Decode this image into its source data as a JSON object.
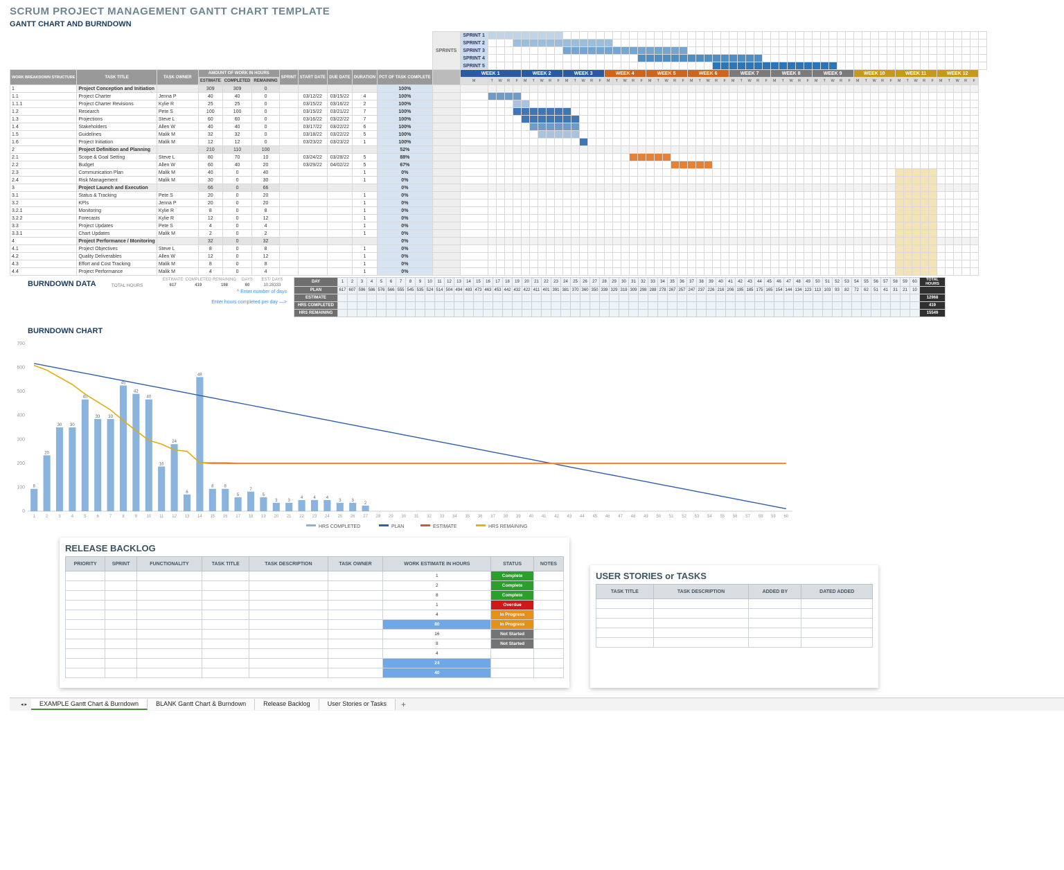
{
  "titles": {
    "main": "SCRUM PROJECT MANAGEMENT GANTT CHART TEMPLATE",
    "sub": "GANTT CHART AND BURNDOWN",
    "burndata": "BURNDOWN DATA",
    "burnchart": "BURNDOWN CHART",
    "backlog": "RELEASE BACKLOG",
    "stories": "USER STORIES or TASKS"
  },
  "headers": {
    "wbs": "WORK BREAKDOWN STRUCTURE",
    "title": "TASK TITLE",
    "owner": "TASK OWNER",
    "amtgroup": "AMOUNT OF WORK IN HOURS",
    "est": "ESTIMATE",
    "comp": "COMPLETED",
    "rem": "REMAINING",
    "sprint": "SPRINT",
    "start": "START DATE",
    "due": "DUE DATE",
    "dur": "DURATION",
    "pct": "PCT OF TASK COMPLETE",
    "sprints": "SPRINTS"
  },
  "sprintlabels": [
    "SPRINT 1",
    "SPRINT 2",
    "SPRINT 3",
    "SPRINT 4",
    "SPRINT 5"
  ],
  "weeks": [
    {
      "label": "WEEK 1",
      "cls": "w-blue"
    },
    {
      "label": "WEEK 2",
      "cls": "w-blue"
    },
    {
      "label": "WEEK 3",
      "cls": "w-blue"
    },
    {
      "label": "WEEK 4",
      "cls": "w-orange"
    },
    {
      "label": "WEEK 5",
      "cls": "w-orange"
    },
    {
      "label": "WEEK 6",
      "cls": "w-orange"
    },
    {
      "label": "WEEK 7",
      "cls": "w-gray"
    },
    {
      "label": "WEEK 8",
      "cls": "w-gray"
    },
    {
      "label": "WEEK 9",
      "cls": "w-gray"
    },
    {
      "label": "WEEK 10",
      "cls": "w-gold"
    },
    {
      "label": "WEEK 11",
      "cls": "w-gold"
    },
    {
      "label": "WEEK 12",
      "cls": "w-gold"
    }
  ],
  "daylabels": [
    "M",
    "T",
    "W",
    "R",
    "F"
  ],
  "rows": [
    {
      "wbs": "1",
      "title": "Project Conception and Initiation",
      "owner": "",
      "e": 309,
      "c": 309,
      "r": 0,
      "sprint": "",
      "start": "",
      "due": "",
      "dur": "",
      "pct": "100%",
      "cat": true,
      "bars": []
    },
    {
      "wbs": "1.1",
      "title": "Project Charter",
      "owner": "Jenna P",
      "e": 40,
      "c": 40,
      "r": 0,
      "sprint": "",
      "start": "03/12/22",
      "due": "03/15/22",
      "dur": 4,
      "pct": "100%",
      "bars": [
        [
          0,
          1,
          4,
          "b2"
        ]
      ]
    },
    {
      "wbs": "1.1.1",
      "title": "Project Charter Revisions",
      "owner": "Kylie R",
      "e": 25,
      "c": 25,
      "r": 0,
      "sprint": "",
      "start": "03/15/22",
      "due": "03/16/22",
      "dur": 2,
      "pct": "100%",
      "bars": [
        [
          0,
          4,
          2,
          "b1"
        ]
      ]
    },
    {
      "wbs": "1.2",
      "title": "Research",
      "owner": "Pete S",
      "e": 100,
      "c": 100,
      "r": 0,
      "sprint": "",
      "start": "03/15/22",
      "due": "03/21/22",
      "dur": 7,
      "pct": "100%",
      "bars": [
        [
          0,
          4,
          7,
          "b3"
        ]
      ]
    },
    {
      "wbs": "1.3",
      "title": "Projections",
      "owner": "Steve L",
      "e": 60,
      "c": 60,
      "r": 0,
      "sprint": "",
      "start": "03/16/22",
      "due": "03/22/22",
      "dur": 7,
      "pct": "100%",
      "bars": [
        [
          1,
          0,
          7,
          "b3"
        ]
      ]
    },
    {
      "wbs": "1.4",
      "title": "Stakeholders",
      "owner": "Allen W",
      "e": 40,
      "c": 40,
      "r": 0,
      "sprint": "",
      "start": "03/17/22",
      "due": "03/22/22",
      "dur": 6,
      "pct": "100%",
      "bars": [
        [
          1,
          1,
          6,
          "b2"
        ]
      ]
    },
    {
      "wbs": "1.5",
      "title": "Guidelines",
      "owner": "Malik M",
      "e": 32,
      "c": 32,
      "r": 0,
      "sprint": "",
      "start": "03/18/22",
      "due": "03/22/22",
      "dur": 5,
      "pct": "100%",
      "bars": [
        [
          1,
          2,
          5,
          "b1"
        ]
      ]
    },
    {
      "wbs": "1.6",
      "title": "Project Initiation",
      "owner": "Malik M",
      "e": 12,
      "c": 12,
      "r": 0,
      "sprint": "",
      "start": "03/23/22",
      "due": "03/23/22",
      "dur": 1,
      "pct": "100%",
      "bars": [
        [
          2,
          2,
          1,
          "b3"
        ]
      ]
    },
    {
      "wbs": "2",
      "title": "Project Definition and Planning",
      "owner": "",
      "e": 210,
      "c": 110,
      "r": 100,
      "sprint": "",
      "start": "",
      "due": "",
      "dur": "",
      "pct": "52%",
      "cat": true,
      "bars": []
    },
    {
      "wbs": "2.1",
      "title": "Scope & Goal Setting",
      "owner": "Steve L",
      "e": 80,
      "c": 70,
      "r": 10,
      "sprint": "",
      "start": "03/24/22",
      "due": "03/28/22",
      "dur": 5,
      "pct": "88%",
      "bars": [
        [
          3,
          3,
          5,
          "o"
        ]
      ]
    },
    {
      "wbs": "2.2",
      "title": "Budget",
      "owner": "Allen W",
      "e": 60,
      "c": 40,
      "r": 20,
      "sprint": "",
      "start": "03/29/22",
      "due": "04/02/22",
      "dur": 5,
      "pct": "67%",
      "bars": [
        [
          4,
          3,
          5,
          "o"
        ]
      ]
    },
    {
      "wbs": "2.3",
      "title": "Communication Plan",
      "owner": "Malik M",
      "e": 40,
      "c": 0,
      "r": 40,
      "sprint": "",
      "start": "",
      "due": "",
      "dur": 1,
      "pct": "0%",
      "bars": [],
      "gold": true
    },
    {
      "wbs": "2.4",
      "title": "Risk Management",
      "owner": "Malik M",
      "e": 30,
      "c": 0,
      "r": 30,
      "sprint": "",
      "start": "",
      "due": "",
      "dur": 1,
      "pct": "0%",
      "bars": [],
      "gold": true
    },
    {
      "wbs": "3",
      "title": "Project Launch and Execution",
      "owner": "",
      "e": 66,
      "c": 0,
      "r": 66,
      "sprint": "",
      "start": "",
      "due": "",
      "dur": "",
      "pct": "0%",
      "cat": true,
      "bars": [],
      "gold": true
    },
    {
      "wbs": "3.1",
      "title": "Status & Tracking",
      "owner": "Pete S",
      "e": 20,
      "c": 0,
      "r": 20,
      "sprint": "",
      "start": "",
      "due": "",
      "dur": 1,
      "pct": "0%",
      "bars": [],
      "gold": true
    },
    {
      "wbs": "3.2",
      "title": "KPIs",
      "owner": "Jenna P",
      "e": 20,
      "c": 0,
      "r": 20,
      "sprint": "",
      "start": "",
      "due": "",
      "dur": 1,
      "pct": "0%",
      "bars": [],
      "gold": true
    },
    {
      "wbs": "3.2.1",
      "title": "Monitoring",
      "owner": "Kylie R",
      "e": 8,
      "c": 0,
      "r": 8,
      "sprint": "",
      "start": "",
      "due": "",
      "dur": 1,
      "pct": "0%",
      "bars": [],
      "gold": true
    },
    {
      "wbs": "3.2.2",
      "title": "Forecasts",
      "owner": "Kylie R",
      "e": 12,
      "c": 0,
      "r": 12,
      "sprint": "",
      "start": "",
      "due": "",
      "dur": 1,
      "pct": "0%",
      "bars": [],
      "gold": true
    },
    {
      "wbs": "3.3",
      "title": "Project Updates",
      "owner": "Pete S",
      "e": 4,
      "c": 0,
      "r": 4,
      "sprint": "",
      "start": "",
      "due": "",
      "dur": 1,
      "pct": "0%",
      "bars": [],
      "gold": true
    },
    {
      "wbs": "3.3.1",
      "title": "Chart Updates",
      "owner": "Malik M",
      "e": 2,
      "c": 0,
      "r": 2,
      "sprint": "",
      "start": "",
      "due": "",
      "dur": 1,
      "pct": "0%",
      "bars": [],
      "gold": true
    },
    {
      "wbs": "4",
      "title": "Project Performance / Monitoring",
      "owner": "",
      "e": 32,
      "c": 0,
      "r": 32,
      "sprint": "",
      "start": "",
      "due": "",
      "dur": "",
      "pct": "0%",
      "cat": true,
      "bars": [],
      "gold": true
    },
    {
      "wbs": "4.1",
      "title": "Project Objectives",
      "owner": "Steve L",
      "e": 8,
      "c": 0,
      "r": 8,
      "sprint": "",
      "start": "",
      "due": "",
      "dur": 1,
      "pct": "0%",
      "bars": [],
      "gold": true
    },
    {
      "wbs": "4.2",
      "title": "Quality Deliverables",
      "owner": "Allen W",
      "e": 12,
      "c": 0,
      "r": 12,
      "sprint": "",
      "start": "",
      "due": "",
      "dur": 1,
      "pct": "0%",
      "bars": [],
      "gold": true
    },
    {
      "wbs": "4.3",
      "title": "Effort and Cost Tracking",
      "owner": "Malik M",
      "e": 8,
      "c": 0,
      "r": 8,
      "sprint": "",
      "start": "",
      "due": "",
      "dur": 1,
      "pct": "0%",
      "bars": [],
      "gold": true
    },
    {
      "wbs": "4.4",
      "title": "Project Performance",
      "owner": "Malik M",
      "e": 4,
      "c": 0,
      "r": 4,
      "sprint": "",
      "start": "",
      "due": "",
      "dur": 1,
      "pct": "0%",
      "bars": [],
      "gold": true
    }
  ],
  "totals": {
    "label": "TOTAL HOURS",
    "e": 617,
    "c": 419,
    "r": 198,
    "days": 60,
    "estdays": "10.28333",
    "hint1": "^  Enter number of days",
    "hint2": "Enter hours completed per day —>",
    "sublabels": {
      "e": "ESTIMATE",
      "c": "COMPLETED",
      "r": "REMAINING",
      "d": "DAYS",
      "ed": "EST/ DAYS"
    }
  },
  "burntbl": {
    "rows": [
      "DAY",
      "PLAN",
      "ESTIMATE",
      "HRS COMPLETED",
      "HRS REMAINING"
    ],
    "totals_label": "TOTAL HOURS",
    "days": 60,
    "plan": [
      617,
      606.7,
      596.4,
      586.1,
      575.9,
      565.6,
      555.3,
      545,
      534.7,
      524.4,
      514.2,
      503.9,
      493.6,
      483.3,
      473,
      462.8,
      452.5,
      442.2,
      431.9,
      421.6,
      411.3,
      401.1,
      390.8,
      380.5,
      370.2,
      359.9,
      349.6,
      339.4,
      329.1,
      318.8,
      308.5,
      298.2,
      287.9,
      277.7,
      267.4,
      257.1,
      246.8,
      236.5,
      226.2,
      216,
      205.7,
      195.4,
      185.1,
      174.8,
      164.5,
      154.3,
      144,
      133.7,
      123.4,
      113.1,
      102.8,
      92.6,
      82.3,
      72,
      61.7,
      51.4,
      41.1,
      30.9,
      20.6,
      10.3
    ],
    "total_estimate": 12968,
    "total_completed": 419,
    "total_remaining": 15549
  },
  "chart_data": {
    "type": "bar+line",
    "title": "",
    "x": [
      1,
      2,
      3,
      4,
      5,
      6,
      7,
      8,
      9,
      10,
      11,
      12,
      13,
      14,
      15,
      16,
      17,
      18,
      19,
      20,
      21,
      22,
      23,
      24,
      25,
      26,
      27,
      28,
      29,
      30,
      31,
      32,
      33,
      34,
      35,
      36,
      37,
      38,
      39,
      40,
      41,
      42,
      43,
      44,
      45,
      46,
      47,
      48,
      49,
      50,
      51,
      52,
      53,
      54,
      55,
      56,
      57,
      58,
      59,
      60
    ],
    "series": [
      {
        "name": "HRS COMPLETED",
        "type": "bar",
        "color": "#8ab4dd",
        "values": [
          8,
          20,
          30,
          30,
          40,
          33,
          33,
          45,
          42,
          40,
          16,
          24,
          6,
          48,
          8,
          8,
          5,
          7,
          5,
          3,
          3,
          4,
          4,
          4,
          3,
          3,
          2,
          0,
          0,
          0,
          0,
          0,
          0,
          0,
          0,
          0,
          0,
          0,
          0,
          0,
          0,
          0,
          0,
          0,
          0,
          0,
          0,
          0,
          0,
          0,
          0,
          0,
          0,
          0,
          0,
          0,
          0,
          0,
          0,
          0
        ]
      },
      {
        "name": "PLAN",
        "type": "line",
        "color": "#2f5fa8",
        "values": [
          617,
          606.7,
          596.4,
          586.1,
          575.9,
          565.6,
          555.3,
          545,
          534.7,
          524.4,
          514.2,
          503.9,
          493.6,
          483.3,
          473,
          462.8,
          452.5,
          442.2,
          431.9,
          421.6,
          411.3,
          401.1,
          390.8,
          380.5,
          370.2,
          359.9,
          349.6,
          339.4,
          329.1,
          318.8,
          308.5,
          298.2,
          287.9,
          277.7,
          267.4,
          257.1,
          246.8,
          236.5,
          226.2,
          216,
          205.7,
          195.4,
          185.1,
          174.8,
          164.5,
          154.3,
          144,
          133.7,
          123.4,
          113.1,
          102.8,
          92.6,
          82.3,
          72,
          61.7,
          51.4,
          41.1,
          30.9,
          20.6,
          10.3
        ]
      },
      {
        "name": "ESTIMATE",
        "type": "line",
        "color": "#d6582f",
        "values": [
          609,
          589,
          559,
          529,
          489,
          456,
          423,
          378,
          336,
          296,
          280,
          256,
          250,
          202,
          202,
          202,
          200,
          200,
          200,
          200,
          200,
          200,
          200,
          200,
          200,
          200,
          200,
          200,
          200,
          200,
          200,
          200,
          200,
          200,
          200,
          200,
          200,
          200,
          200,
          200,
          200,
          200,
          200,
          200,
          200,
          200,
          200,
          200,
          200,
          200,
          200,
          200,
          200,
          200,
          200,
          200,
          200,
          200,
          200,
          200
        ]
      },
      {
        "name": "HRS REMAINING",
        "type": "line",
        "color": "#e3b400",
        "values": [
          609,
          589,
          559,
          529,
          489,
          456,
          423,
          378,
          336,
          296,
          280,
          256,
          250,
          202,
          198,
          198,
          198,
          198,
          198,
          198,
          198,
          198,
          198,
          198,
          198,
          198,
          198,
          198,
          198,
          198,
          198,
          198,
          198,
          198,
          198,
          198,
          198,
          198,
          198,
          198,
          198,
          198,
          198,
          198,
          198,
          198,
          198,
          198,
          198,
          198,
          198,
          198,
          198,
          198,
          198,
          198,
          198,
          198,
          198,
          198
        ]
      }
    ],
    "ylim_left": [
      0,
      700
    ],
    "ylim_right": [
      0,
      60
    ],
    "yticks_left": [
      0,
      100,
      200,
      300,
      400,
      500,
      600,
      700
    ],
    "legend": [
      "HRS COMPLETED",
      "PLAN",
      "ESTIMATE",
      "HRS REMAINING"
    ]
  },
  "backlog": {
    "headers": [
      "PRIORITY",
      "SPRINT",
      "FUNCTIONALITY",
      "TASK TITLE",
      "TASK DESCRIPTION",
      "TASK OWNER",
      "WORK ESTIMATE IN HOURS",
      "STATUS",
      "NOTES"
    ],
    "rows": [
      {
        "est": 1,
        "status": "Complete",
        "cls": "st-green"
      },
      {
        "est": 2,
        "status": "Complete",
        "cls": "st-green"
      },
      {
        "est": 8,
        "status": "Complete",
        "cls": "st-green"
      },
      {
        "est": 1,
        "status": "Overdue",
        "cls": "st-red"
      },
      {
        "est": 4,
        "status": "In Progress",
        "cls": "st-orange"
      },
      {
        "est": 80,
        "status": "In Progress",
        "cls": "st-orange",
        "hl": true
      },
      {
        "est": 16,
        "status": "Not Started",
        "cls": "st-gray"
      },
      {
        "est": 8,
        "status": "Not Started",
        "cls": "st-gray"
      },
      {
        "est": 4,
        "status": "",
        "cls": ""
      },
      {
        "est": 24,
        "status": "",
        "cls": "",
        "hl": true
      },
      {
        "est": 40,
        "status": "",
        "cls": "",
        "hl": true
      }
    ]
  },
  "stories": {
    "headers": [
      "TASK TITLE",
      "TASK DESCRIPTION",
      "ADDED BY",
      "DATED ADDED"
    ]
  },
  "sheets": [
    "EXAMPLE Gantt Chart & Burndown",
    "BLANK Gantt Chart & Burndown",
    "Release Backlog",
    "User Stories or Tasks"
  ]
}
